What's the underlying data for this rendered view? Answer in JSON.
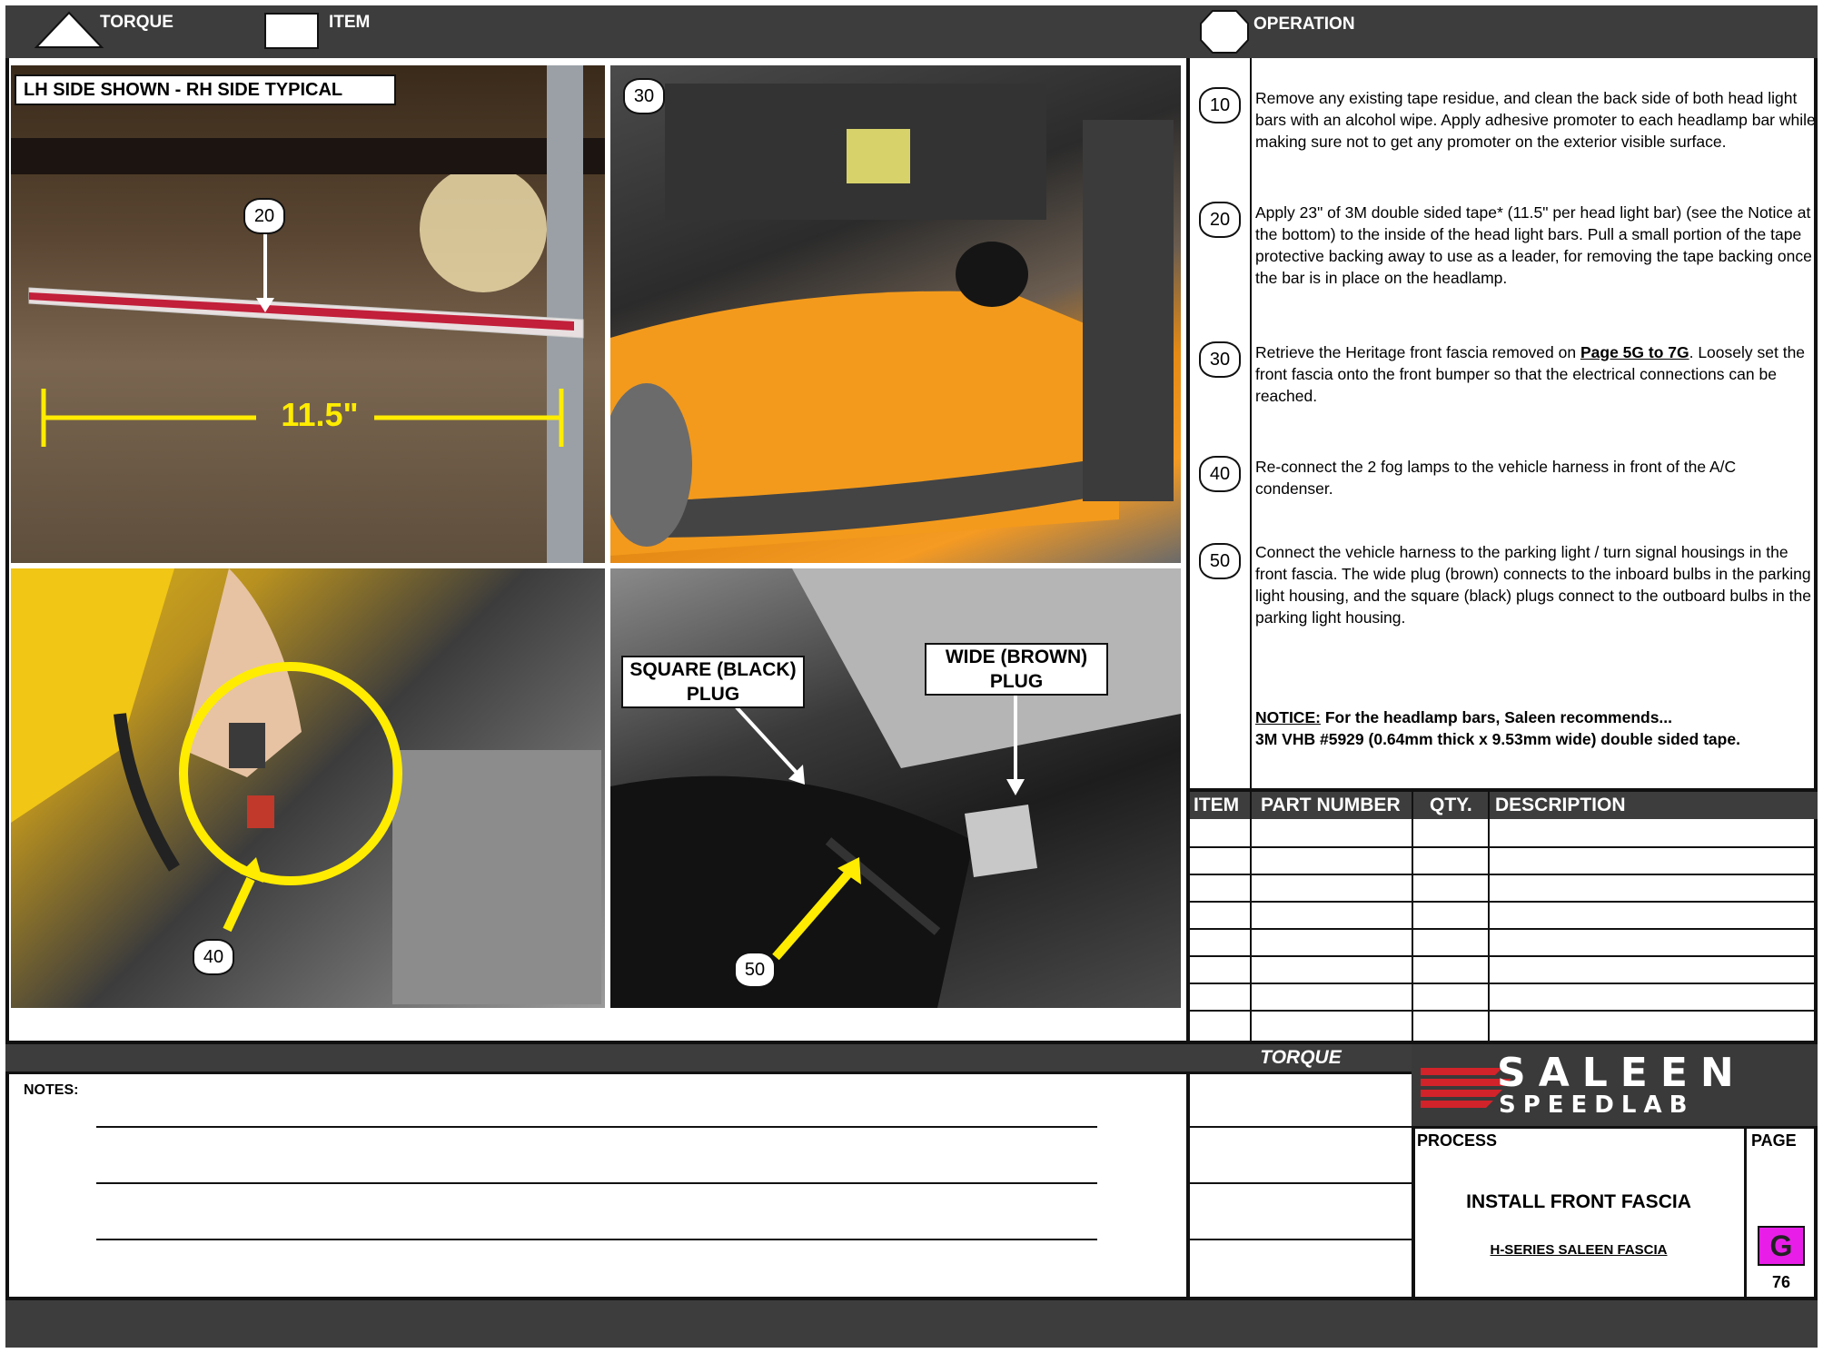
{
  "header": {
    "torque_label": "TORQUE",
    "item_label": "ITEM",
    "operation_label": "OPERATION"
  },
  "photos": {
    "photo1": {
      "caption": "LH SIDE SHOWN - RH SIDE TYPICAL",
      "step": "20",
      "dimension": "11.5\""
    },
    "photo2": {
      "step": "30"
    },
    "photo3": {
      "step": "40"
    },
    "photo4": {
      "step": "50",
      "square_plug": "SQUARE (BLACK)\nPLUG",
      "wide_plug": "WIDE (BROWN)\nPLUG"
    }
  },
  "operations": [
    {
      "step": "10",
      "text": "Remove any existing tape residue, and clean the back side of both head light bars with an alcohol wipe. Apply adhesive promoter to each headlamp bar while making sure not to get any promoter on the exterior visible surface."
    },
    {
      "step": "20",
      "text": "Apply 23\" of 3M double sided tape* (11.5\" per head light bar) (see the Notice at the bottom) to the inside of the head light bars.  Pull a small portion of the tape protective backing away to use as a leader, for removing the tape backing once the bar is in place on the headlamp."
    },
    {
      "step": "30",
      "text_before": "Retrieve the Heritage front fascia removed on ",
      "link": "Page 5G to 7G",
      "text_after": ".  Loosely set the front fascia onto the front bumper so that the electrical connections can be reached."
    },
    {
      "step": "40",
      "text": "Re-connect the 2 fog lamps to the vehicle harness in front of the A/C condenser."
    },
    {
      "step": "50",
      "text": "Connect the vehicle harness to the parking light / turn signal housings in the front fascia.  The wide plug (brown) connects to the inboard bulbs in the parking light housing, and the square (black) plugs connect to the outboard bulbs in the parking light housing."
    }
  ],
  "notice": {
    "label": "NOTICE:",
    "line1": "  For the headlamp bars, Saleen recommends...",
    "line2": "3M VHB #5929 (0.64mm thick x 9.53mm wide) double sided tape."
  },
  "parts_table": {
    "headers": [
      "ITEM",
      "PART NUMBER",
      "QTY.",
      "DESCRIPTION"
    ]
  },
  "torque_box": {
    "label": "TORQUE"
  },
  "notes": {
    "label": "NOTES:"
  },
  "title_block": {
    "logo_line1": "SALEEN",
    "logo_line2": "SPEEDLAB",
    "process_label": "PROCESS",
    "page_label": "PAGE",
    "process_title": "INSTALL FRONT FASCIA",
    "process_subtitle": "H-SERIES SALEEN FASCIA",
    "page_letter": "G",
    "page_number": "76"
  },
  "colors": {
    "header_bg": "#3d3d3d",
    "callout_yellow": "#ffec00",
    "page_badge": "#e81ee8",
    "logo_red": "#d2232a"
  }
}
